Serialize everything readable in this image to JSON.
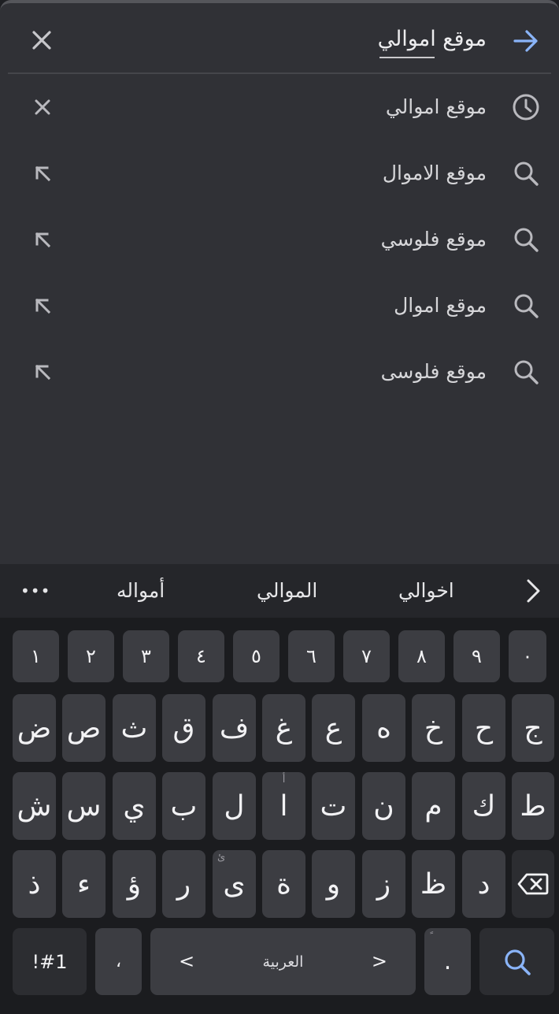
{
  "search": {
    "query": "موقع اموالي"
  },
  "suggestions": [
    {
      "text": "موقع اموالي",
      "type": "history",
      "lead_icon": "history-clock-icon",
      "action_icon": "remove-x-icon"
    },
    {
      "text": "موقع الاموال",
      "type": "search",
      "lead_icon": "search-icon",
      "action_icon": "fill-arrow-icon"
    },
    {
      "text": "موقع فلوسي",
      "type": "search",
      "lead_icon": "search-icon",
      "action_icon": "fill-arrow-icon"
    },
    {
      "text": "موقع اموال",
      "type": "search",
      "lead_icon": "search-icon",
      "action_icon": "fill-arrow-icon"
    },
    {
      "text": "موقع فلوسى",
      "type": "search",
      "lead_icon": "search-icon",
      "action_icon": "fill-arrow-icon"
    }
  ],
  "keyboard": {
    "predictions": [
      "اخوالي",
      "الموالي",
      "أمواله"
    ],
    "more_label": "•••",
    "row_numbers": [
      "١",
      "٢",
      "٣",
      "٤",
      "٥",
      "٦",
      "٧",
      "٨",
      "٩",
      "٠"
    ],
    "row1": [
      "ض",
      "ص",
      "ث",
      "ق",
      "ف",
      "غ",
      "ع",
      "ه",
      "خ",
      "ح",
      "ج"
    ],
    "row2": [
      "ش",
      "س",
      "ي",
      "ب",
      "ل",
      "ا",
      "ت",
      "ن",
      "م",
      "ك",
      "ط"
    ],
    "row2_hints": [
      "",
      "",
      "",
      "",
      "",
      "أ",
      "",
      "",
      "",
      "",
      ""
    ],
    "row3": [
      "ذ",
      "ء",
      "ؤ",
      "ر",
      "ى",
      "ة",
      "و",
      "ز",
      "ظ",
      "د"
    ],
    "row3_hints": [
      "",
      "",
      "",
      "",
      "ئ",
      "",
      "",
      "",
      "",
      ""
    ],
    "symbols_label": "!#1",
    "comma_label": "،",
    "space_label": "العربية",
    "period_label": ".",
    "period_hint": "ً",
    "left_arrow": "<",
    "right_arrow": ">"
  },
  "colors": {
    "accent": "#8ab4f8",
    "panel_bg": "#303136",
    "keyboard_bg": "#1b1c1f",
    "key_bg": "#3c3d42"
  }
}
